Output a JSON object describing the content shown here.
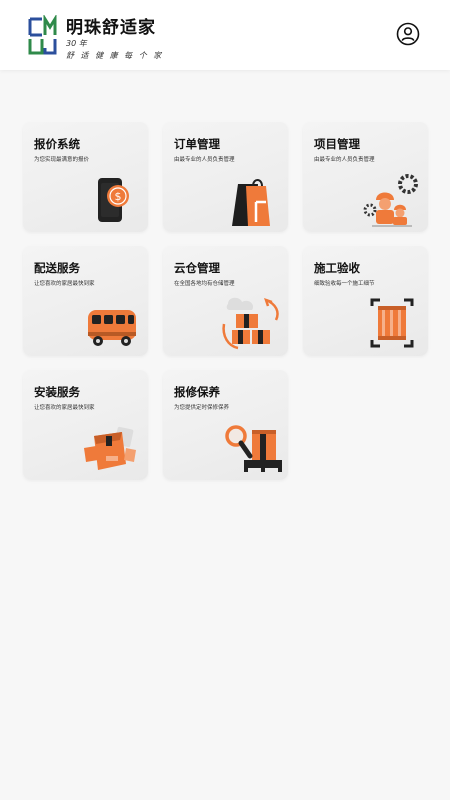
{
  "header": {
    "logo_letters": "CMUJ",
    "brand_name": "明珠舒适家",
    "years": "30 年",
    "slogan": "舒 适 健 康 每 个 家",
    "user_icon": "user-circle-icon"
  },
  "services": [
    {
      "title": "报价系统",
      "desc": "为您实现最满意的报价",
      "icon": "phone-dollar-icon"
    },
    {
      "title": "订单管理",
      "desc": "由最专业的人员负责管理",
      "icon": "shopping-bag-icon"
    },
    {
      "title": "项目管理",
      "desc": "由最专业的人员负责管理",
      "icon": "workers-gear-icon"
    },
    {
      "title": "配送服务",
      "desc": "让您喜欢的家居最快到家",
      "icon": "delivery-van-icon"
    },
    {
      "title": "云仓管理",
      "desc": "在全国各地均有仓储管理",
      "icon": "cloud-warehouse-icon"
    },
    {
      "title": "施工验收",
      "desc": "细致验收每一个施工细节",
      "icon": "crate-inspection-icon"
    },
    {
      "title": "安装服务",
      "desc": "让您喜欢的家居最快到家",
      "icon": "package-hands-icon"
    },
    {
      "title": "报修保养",
      "desc": "为您提供定时保修保养",
      "icon": "repair-magnifier-icon"
    }
  ],
  "colors": {
    "accent_orange": "#ef7a3a",
    "dark": "#222222",
    "logo_green": "#2f8a4a",
    "logo_blue": "#2b4f9c"
  }
}
